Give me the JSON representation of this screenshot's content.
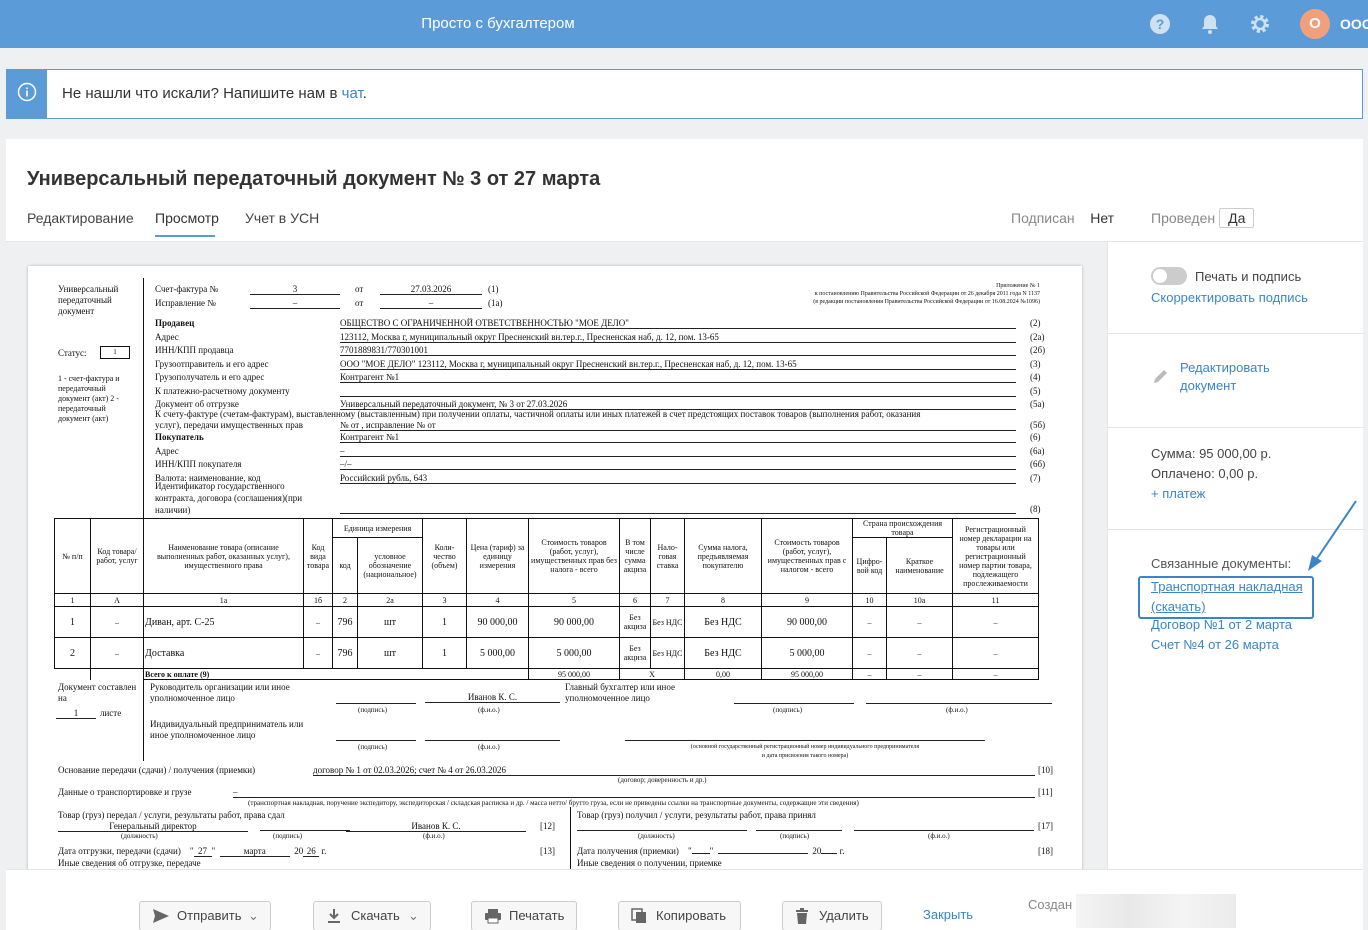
{
  "topbar": {
    "title": "Просто с бухгалтером",
    "avatar_letter": "О",
    "org": "ООО"
  },
  "info": {
    "text": "Не нашли что искали? Напишите нам в ",
    "link": "чат",
    "end": "."
  },
  "page": {
    "title": "Универсальный передаточный документ № 3 от 27 марта"
  },
  "tabs": [
    "Редактирование",
    "Просмотр",
    "Учет в УСН"
  ],
  "status": {
    "signed_label": "Подписан",
    "signed_value": "Нет",
    "posted_label": "Проведен",
    "posted_value": "Да"
  },
  "sidebar": {
    "print_sign": "Печать и подпись",
    "fix_sign": "Скорректировать подпись",
    "edit_l1": "Редактировать",
    "edit_l2": "документ",
    "sum": "Сумма: 95 000,00 р.",
    "paid": "Оплачено: 0,00 р.",
    "payment": "+ платеж",
    "related": "Связанные документы:",
    "rel1_l1": "Транспортная накладная",
    "rel1_l2": "(скачать)",
    "rel2": "Договор №1 от 2 марта",
    "rel3": "Счет №4 от 26 марта"
  },
  "bottom": {
    "send": "Отправить",
    "download": "Скачать",
    "print": "Печатать",
    "copy": "Копировать",
    "delete": "Удалить",
    "close": "Закрыть",
    "created": "Создан"
  },
  "colors": {
    "accent": "#5b9bd8",
    "link": "#3a85c7"
  },
  "doc": {
    "doc_type": "Универсальный передаточный документ",
    "status_label": "Статус:",
    "status_value": "1",
    "status_note": "1 - счет-фактура и передаточный документ (акт) 2 - передаточный документ (акт)",
    "invoice_label": "Счет-фактура №",
    "invoice_no": "3",
    "ot": "от",
    "invoice_date": "27.03.2026",
    "n1": "(1)",
    "fix_label": "Исправление №",
    "fix_no": "–",
    "fix_date": "–",
    "n1a": "(1а)",
    "annex": "Приложение № 1",
    "annex2": "к постановлению Правительства Российской Федерации от 26 декабря 2011 года N 1137",
    "annex3": "(в редакции постановления Правительства Российской Федерации от 16.08.2024 №1096)",
    "rows": [
      {
        "label": "Продавец",
        "value": "ОБЩЕСТВО С ОГРАНИЧЕННОЙ ОТВЕТСТВЕННОСТЬЮ \"МОЕ ДЕЛО\"",
        "num": "(2)",
        "bold": true
      },
      {
        "label": "Адрес",
        "value": "123112, Москва г, муниципальный округ Пресненский вн.тер.г., Пресненская наб, д. 12, пом. 13-65",
        "num": "(2а)"
      },
      {
        "label": "ИНН/КПП продавца",
        "value": "7701889831/770301001",
        "num": "(2б)"
      },
      {
        "label": "Грузоотправитель и его адрес",
        "value": "ООО  \"МОЕ ДЕЛО\" 123112, Москва г, муниципальный округ Пресненский вн.тер.г., Пресненская наб, д. 12, пом. 13-65",
        "num": "(3)"
      },
      {
        "label": "Грузополучатель и его адрес",
        "value": "Контрагент №1",
        "num": "(4)"
      },
      {
        "label": "К платежно-расчетному документу",
        "value": "",
        "num": "(5)"
      },
      {
        "label": "Документ об отгрузке",
        "value": "Универсальный передаточный документ, № 3 от 27.03.2026",
        "num": "(5а)"
      }
    ],
    "advance_l1": "К счету-фактуре (счетам-фактурам), выставленному (выставленным) при получении оплаты, частичной оплаты или иных платежей в счет предстоящих поставок товаров (выполнения работ, оказания",
    "advance_l2": "услуг), передачи имущественных прав",
    "advance_value": "№ от , исправление № от",
    "n5b": "(5б)",
    "rows2": [
      {
        "label": "Покупатель",
        "value": "Контрагент №1",
        "num": "(6)",
        "bold": true
      },
      {
        "label": "Адрес",
        "value": "–",
        "num": "(6а)"
      },
      {
        "label": "ИНН/КПП покупателя",
        "value": "–/–",
        "num": "(6б)"
      },
      {
        "label": "Валюта: наименование, код",
        "value": "Российский рубль, 643",
        "num": "(7)"
      }
    ],
    "gov_l1": "Идентификатор государственного",
    "gov_l2": "контракта, договора (соглашения)(при",
    "gov_l3": "наличии)",
    "n8": "(8)",
    "th": {
      "no": "№ п/п",
      "code": "Код товара/ работ, услуг",
      "name": "Наименование товара (описание выполненных работ, оказанных услуг), имущественного права",
      "kind": "Код вида товара",
      "unit": "Единица измерения",
      "unit_code": "код",
      "unit_name": "условное обозначение (национальное)",
      "qty": "Коли- чество (объем)",
      "price": "Цена (тариф) за единицу измерения",
      "cost": "Стоимость товаров (работ, услуг), имущественных прав без налога - всего",
      "excise": "В том числе сумма акциза",
      "rate": "Нало- говая ставка",
      "tax": "Сумма налога, предъявляемая покупателю",
      "total": "Стоимость товаров (работ, услуг), имущественных прав с налогом - всего",
      "country": "Страна происхождения товара",
      "country_code": "Цифро- вой код",
      "country_name": "Краткое наименование",
      "decl": "Регистрационный номер декларации на товары или регистрационный номер партии товара, подлежащего прослеживаемости"
    },
    "colnums": [
      "1",
      "А",
      "1а",
      "1б",
      "2",
      "2а",
      "3",
      "4",
      "5",
      "6",
      "7",
      "8",
      "9",
      "10",
      "10а",
      "11"
    ],
    "items": [
      {
        "no": "1",
        "code": "–",
        "name": "Диван, арт. С-25",
        "kind": "–",
        "ucode": "796",
        "uname": "шт",
        "qty": "1",
        "price": "90 000,00",
        "cost": "90 000,00",
        "excise": "Без акциза",
        "rate": "Без НДС",
        "tax": "Без НДС",
        "total": "90 000,00",
        "cc": "–",
        "cn": "–",
        "decl": "–"
      },
      {
        "no": "2",
        "code": "–",
        "name": "Доставка",
        "kind": "–",
        "ucode": "796",
        "uname": "шт",
        "qty": "1",
        "price": "5 000,00",
        "cost": "5 000,00",
        "excise": "Без акциза",
        "rate": "Без НДС",
        "tax": "Без НДС",
        "total": "5 000,00",
        "cc": "–",
        "cn": "–",
        "decl": "–"
      }
    ],
    "total_label": "Всего к оплате (9)",
    "total_cost": "95 000,00",
    "total_excise": "Х",
    "total_tax": "0,00",
    "total_total": "95 000,00",
    "composed": "Документ составлен на",
    "sheets": "1",
    "sheets_label": "листе",
    "head": "Руководитель организации или иное уполномоченное лицо",
    "head_name": "Иванов К. С.",
    "acc": "Главный бухгалтер или иное уполномоченное лицо",
    "podpis": "(подпись)",
    "fio": "(ф.и.о.)",
    "ip": "Индивидуальный предприниматель или иное уполномоченное лицо",
    "ogrn": "(основной государственный регистрационный номер индивидуального предпринимателя",
    "ogrn2": "и дата присвоения такого номера)",
    "basis": "Основание передачи (сдачи) / получения (приемки)",
    "basis_value": "договор № 1 от 02.03.2026; счет № 4 от 26.03.2026",
    "n10": "[10]",
    "basis_hint": "(договор; доверенность и др.)",
    "transport": "Данные о транспортировке и грузе",
    "transport_value": "–",
    "n11": "[11]",
    "transport_hint": "(транспортная накладная, поручение экспедитору, экспедиторская / складская расписка и др. / масса нетто/ брутто груза, если не приведены ссылки на транспортные документы, содержащие эти сведения)",
    "passed": "Товар (груз) передал / услуги, результаты работ, права сдал",
    "passed_pos": "Генеральный директор",
    "passed_name": "Иванов К. С.",
    "n12": "[12]",
    "received": "Товар (груз) получил / услуги, результаты работ, права принял",
    "n17": "[17]",
    "dolzh": "(должность)",
    "ship_date": "Дата отгрузки, передачи (сдачи)",
    "day": "27",
    "month": "марта",
    "y20": "20",
    "year": "26",
    "g": "г.",
    "n13": "[13]",
    "recv_date": "Дата получения (приемки)",
    "n18": "[18]",
    "other_ship": "Иные сведения об отгрузке, передаче",
    "other_recv": "Иные сведения о получении, приемке"
  }
}
